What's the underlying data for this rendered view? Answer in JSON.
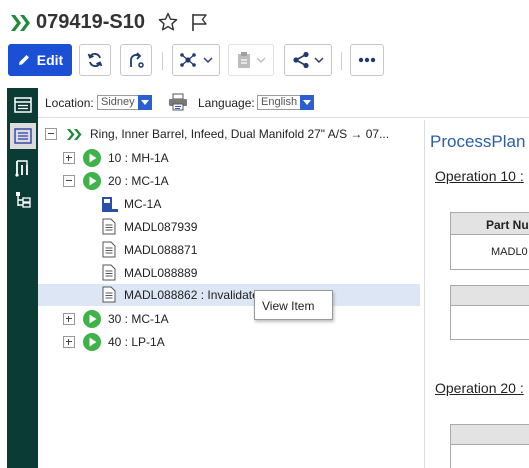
{
  "header": {
    "title": "079419-S10"
  },
  "toolbar": {
    "edit_label": "Edit"
  },
  "location": {
    "label": "Location:",
    "value": "Sidney"
  },
  "language": {
    "label": "Language:",
    "value": "English"
  },
  "tree": {
    "root_label": "Ring, Inner Barrel, Infeed, Dual Manifold 27\" A/S → 07...",
    "items": [
      {
        "label": "10 : MH-1A"
      },
      {
        "label": "20 : MC-1A"
      },
      {
        "label": "MC-1A"
      },
      {
        "label": "MADL087939"
      },
      {
        "label": "MADL088871"
      },
      {
        "label": "MADL088889"
      },
      {
        "label": "MADL088862 : Invalidate"
      },
      {
        "label": "30 : MC-1A"
      },
      {
        "label": "40 : LP-1A"
      }
    ]
  },
  "tooltip": {
    "text": "View Item"
  },
  "content": {
    "title": "ProcessPlan",
    "op10": "Operation 10 :",
    "op20": "Operation 20 :",
    "table_header": "Part Nu",
    "table_cell": "MADL0"
  },
  "colors": {
    "accent": "#1a4fd6",
    "rail": "#0b3b35",
    "play": "#3fb24a",
    "highlight": "#dde6f4"
  }
}
